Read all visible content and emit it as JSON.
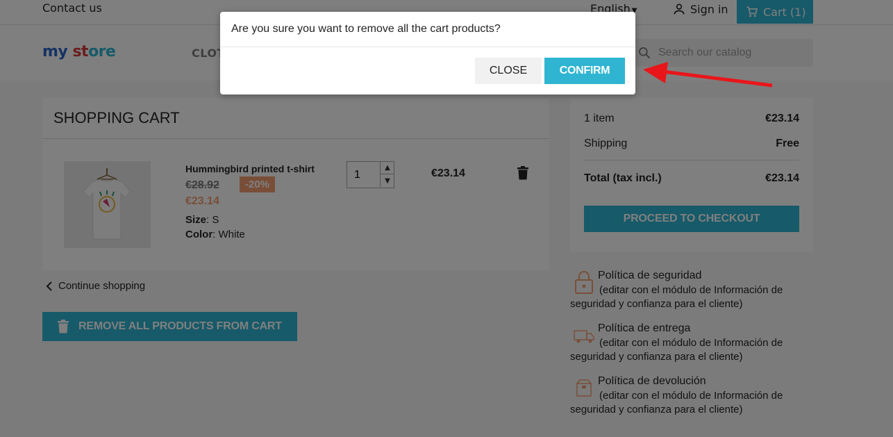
{
  "header": {
    "contact": "Contact us",
    "language": "English",
    "signin": "Sign in",
    "cart": "Cart (1)",
    "logo": [
      "my",
      " ",
      "st",
      "ore"
    ],
    "menu_clothes": "CLOT",
    "search_placeholder": "Search our catalog"
  },
  "cart": {
    "title": "SHOPPING CART",
    "item": {
      "name": "Hummingbird printed t-shirt",
      "old_price": "€28.92",
      "discount": "-20%",
      "price": "€23.14",
      "size_label": "Size",
      "size_value": "S",
      "color_label": "Color",
      "color_value": "White",
      "quantity": "1",
      "total": "€23.14"
    },
    "continue": "Continue shopping",
    "remove_all": "REMOVE ALL PRODUCTS FROM CART"
  },
  "summary": {
    "items_label": "1 item",
    "items_value": "€23.14",
    "shipping_label": "Shipping",
    "shipping_value": "Free",
    "total_label": "Total (tax incl.)",
    "total_value": "€23.14",
    "checkout": "PROCEED TO CHECKOUT"
  },
  "reassurance": [
    {
      "title": "Política de seguridad",
      "desc": "(editar con el módulo de Información de seguridad y confianza para el cliente)",
      "icon": "lock-icon"
    },
    {
      "title": "Política de entrega",
      "desc": "(editar con el módulo de Información de seguridad y confianza para el cliente)",
      "icon": "truck-icon"
    },
    {
      "title": "Política de devolución",
      "desc": "(editar con el módulo de Información de seguridad y confianza para el cliente)",
      "icon": "return-box-icon"
    }
  ],
  "modal": {
    "question": "Are you sure you want to remove all the cart products?",
    "close": "CLOSE",
    "confirm": "CONFIRM"
  },
  "colors": {
    "accent": "#2fb5d2",
    "discount": "#f39d72",
    "annotation_arrow": "#e8161b"
  }
}
